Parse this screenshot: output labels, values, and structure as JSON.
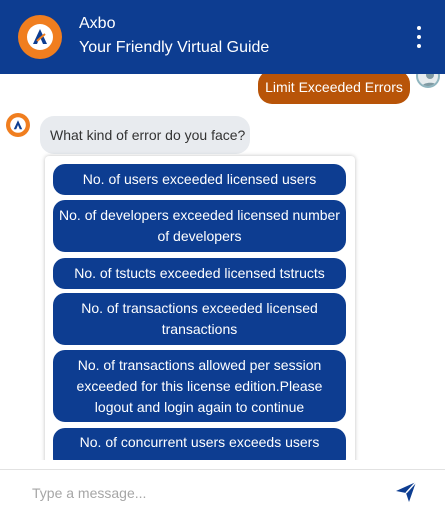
{
  "header": {
    "bot_name": "Axbo",
    "subtitle": "Your Friendly Virtual Guide",
    "menu_icon": "more-vertical-icon",
    "accent": "#0d3d91"
  },
  "chat": {
    "user_message": "Limit Exceeded Errors",
    "user_bubble_color": "#b85408",
    "bot_question": "What kind of error do you face?",
    "options": [
      "No. of users exceeded licensed users",
      "No. of developers exceeded licensed number of developers",
      "No. of tstucts exceeded licensed tstructs",
      "No. of transactions exceeded licensed transactions",
      "No. of transactions allowed per session exceeded for this license edition.Please logout and login again to continue",
      "No. of concurrent users exceeds users"
    ]
  },
  "composer": {
    "placeholder": "Type a message...",
    "send_icon": "send-icon"
  }
}
